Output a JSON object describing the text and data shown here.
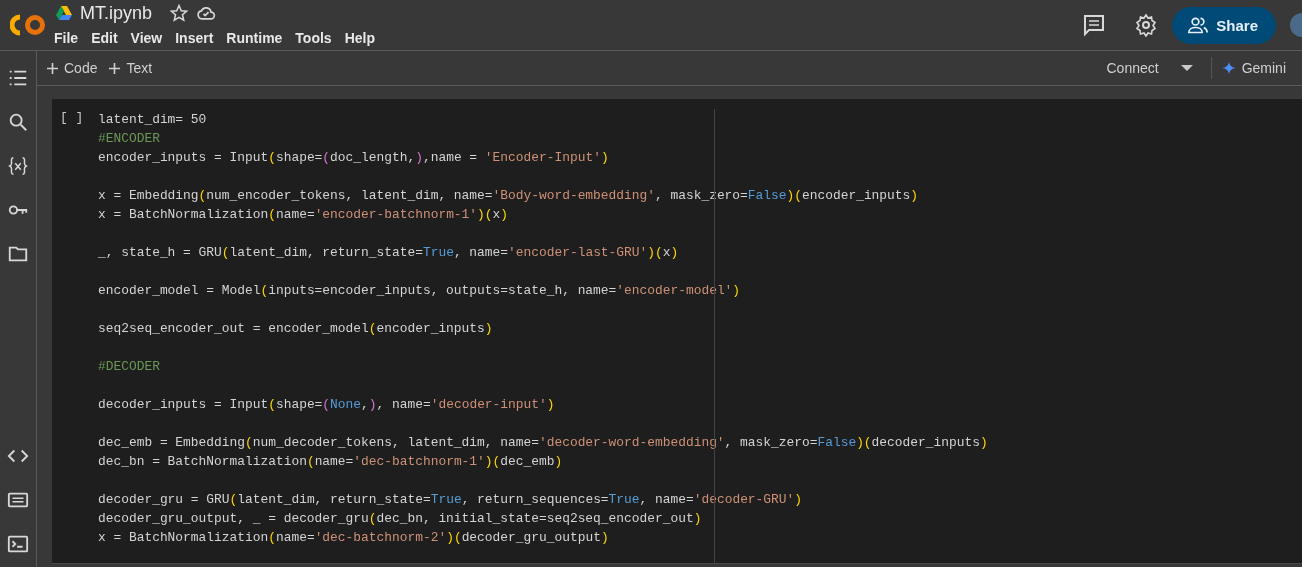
{
  "header": {
    "title": "MT.ipynb",
    "starred": false,
    "menu": [
      "File",
      "Edit",
      "View",
      "Insert",
      "Runtime",
      "Tools",
      "Help"
    ],
    "share_label": "Share"
  },
  "toolbar": {
    "add_buttons": [
      "Code",
      "Text"
    ],
    "connect_label": "Connect",
    "gemini_label": "Gemini"
  },
  "cell": {
    "run_indicator": "[ ]",
    "blocks": [
      [
        [
          {
            "kind": "plain",
            "text": "latent_dim= 50"
          }
        ],
        [
          {
            "kind": "comment",
            "text": "#ENCODER"
          }
        ],
        [
          {
            "kind": "plain",
            "text": "encoder_inputs = Input"
          },
          {
            "kind": "paren",
            "text": "("
          },
          {
            "kind": "plain",
            "text": "shape="
          },
          {
            "kind": "paren2",
            "text": "("
          },
          {
            "kind": "plain",
            "text": "doc_length,"
          },
          {
            "kind": "paren2",
            "text": ")"
          },
          {
            "kind": "plain",
            "text": ",name = "
          },
          {
            "kind": "string",
            "text": "'Encoder-Input'"
          },
          {
            "kind": "paren",
            "text": ")"
          }
        ]
      ],
      [
        [
          {
            "kind": "plain",
            "text": "x = Embedding"
          },
          {
            "kind": "paren",
            "text": "("
          },
          {
            "kind": "plain",
            "text": "num_encoder_tokens, latent_dim, name="
          },
          {
            "kind": "string",
            "text": "'Body-word-embedding'"
          },
          {
            "kind": "plain",
            "text": ", mask_zero="
          },
          {
            "kind": "const",
            "text": "False"
          },
          {
            "kind": "paren",
            "text": ")("
          },
          {
            "kind": "plain",
            "text": "encoder_inputs"
          },
          {
            "kind": "paren",
            "text": ")"
          }
        ],
        [
          {
            "kind": "plain",
            "text": "x = BatchNormalization"
          },
          {
            "kind": "paren",
            "text": "("
          },
          {
            "kind": "plain",
            "text": "name="
          },
          {
            "kind": "string",
            "text": "'encoder-batchnorm-1'"
          },
          {
            "kind": "paren",
            "text": ")("
          },
          {
            "kind": "plain",
            "text": "x"
          },
          {
            "kind": "paren",
            "text": ")"
          }
        ]
      ],
      [
        [
          {
            "kind": "plain",
            "text": "_, state_h = GRU"
          },
          {
            "kind": "paren",
            "text": "("
          },
          {
            "kind": "plain",
            "text": "latent_dim, return_state="
          },
          {
            "kind": "const",
            "text": "True"
          },
          {
            "kind": "plain",
            "text": ", name="
          },
          {
            "kind": "string",
            "text": "'encoder-last-GRU'"
          },
          {
            "kind": "paren",
            "text": ")("
          },
          {
            "kind": "plain",
            "text": "x"
          },
          {
            "kind": "paren",
            "text": ")"
          }
        ]
      ],
      [
        [
          {
            "kind": "plain",
            "text": "encoder_model = Model"
          },
          {
            "kind": "paren",
            "text": "("
          },
          {
            "kind": "plain",
            "text": "inputs=encoder_inputs, outputs=state_h, name="
          },
          {
            "kind": "string",
            "text": "'encoder-model'"
          },
          {
            "kind": "paren",
            "text": ")"
          }
        ]
      ],
      [
        [
          {
            "kind": "plain",
            "text": "seq2seq_encoder_out = encoder_model"
          },
          {
            "kind": "paren",
            "text": "("
          },
          {
            "kind": "plain",
            "text": "encoder_inputs"
          },
          {
            "kind": "paren",
            "text": ")"
          }
        ]
      ],
      [
        [
          {
            "kind": "comment",
            "text": "#DECODER"
          }
        ]
      ],
      [
        [
          {
            "kind": "plain",
            "text": "decoder_inputs = Input"
          },
          {
            "kind": "paren",
            "text": "("
          },
          {
            "kind": "plain",
            "text": "shape="
          },
          {
            "kind": "paren2",
            "text": "("
          },
          {
            "kind": "const",
            "text": "None"
          },
          {
            "kind": "plain",
            "text": ","
          },
          {
            "kind": "paren2",
            "text": ")"
          },
          {
            "kind": "plain",
            "text": ", name="
          },
          {
            "kind": "string",
            "text": "'decoder-input'"
          },
          {
            "kind": "paren",
            "text": ")"
          }
        ]
      ],
      [
        [
          {
            "kind": "plain",
            "text": "dec_emb = Embedding"
          },
          {
            "kind": "paren",
            "text": "("
          },
          {
            "kind": "plain",
            "text": "num_decoder_tokens, latent_dim, name="
          },
          {
            "kind": "string",
            "text": "'decoder-word-embedding'"
          },
          {
            "kind": "plain",
            "text": ", mask_zero="
          },
          {
            "kind": "const",
            "text": "False"
          },
          {
            "kind": "paren",
            "text": ")("
          },
          {
            "kind": "plain",
            "text": "decoder_inputs"
          },
          {
            "kind": "paren",
            "text": ")"
          }
        ],
        [
          {
            "kind": "plain",
            "text": "dec_bn = BatchNormalization"
          },
          {
            "kind": "paren",
            "text": "("
          },
          {
            "kind": "plain",
            "text": "name="
          },
          {
            "kind": "string",
            "text": "'dec-batchnorm-1'"
          },
          {
            "kind": "paren",
            "text": ")("
          },
          {
            "kind": "plain",
            "text": "dec_emb"
          },
          {
            "kind": "paren",
            "text": ")"
          }
        ]
      ],
      [
        [
          {
            "kind": "plain",
            "text": "decoder_gru = GRU"
          },
          {
            "kind": "paren",
            "text": "("
          },
          {
            "kind": "plain",
            "text": "latent_dim, return_state="
          },
          {
            "kind": "const",
            "text": "True"
          },
          {
            "kind": "plain",
            "text": ", return_sequences="
          },
          {
            "kind": "const",
            "text": "True"
          },
          {
            "kind": "plain",
            "text": ", name="
          },
          {
            "kind": "string",
            "text": "'decoder-GRU'"
          },
          {
            "kind": "paren",
            "text": ")"
          }
        ],
        [
          {
            "kind": "plain",
            "text": "decoder_gru_output, _ = decoder_gru"
          },
          {
            "kind": "paren",
            "text": "("
          },
          {
            "kind": "plain",
            "text": "dec_bn, initial_state=seq2seq_encoder_out"
          },
          {
            "kind": "paren",
            "text": ")"
          }
        ],
        [
          {
            "kind": "plain",
            "text": "x = BatchNormalization"
          },
          {
            "kind": "paren",
            "text": "("
          },
          {
            "kind": "plain",
            "text": "name="
          },
          {
            "kind": "string",
            "text": "'dec-batchnorm-2'"
          },
          {
            "kind": "paren",
            "text": ")("
          },
          {
            "kind": "plain",
            "text": "decoder_gru_output"
          },
          {
            "kind": "paren",
            "text": ")"
          }
        ]
      ]
    ]
  }
}
